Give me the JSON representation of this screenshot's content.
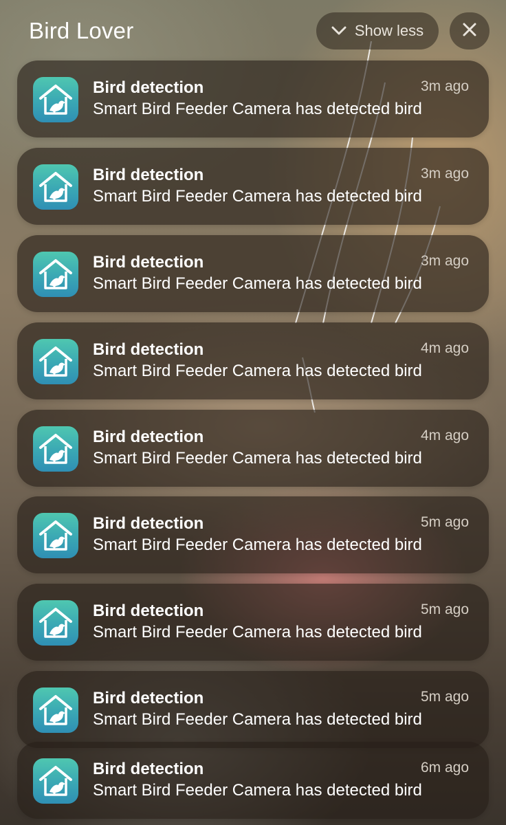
{
  "header": {
    "app_name": "Bird Lover",
    "show_less_label": "Show less",
    "chevron_icon": "chevron-down-icon",
    "close_icon": "close-icon"
  },
  "notifications": [
    {
      "title": "Bird detection",
      "body": "Smart Bird Feeder Camera has detected bird",
      "time": "3m ago"
    },
    {
      "title": "Bird detection",
      "body": "Smart Bird Feeder Camera has detected bird",
      "time": "3m ago"
    },
    {
      "title": "Bird detection",
      "body": "Smart Bird Feeder Camera has detected bird",
      "time": "3m ago"
    },
    {
      "title": "Bird detection",
      "body": "Smart Bird Feeder Camera has detected bird",
      "time": "4m ago"
    },
    {
      "title": "Bird detection",
      "body": "Smart Bird Feeder Camera has detected bird",
      "time": "4m ago"
    },
    {
      "title": "Bird detection",
      "body": "Smart Bird Feeder Camera has detected bird",
      "time": "5m ago"
    },
    {
      "title": "Bird detection",
      "body": "Smart Bird Feeder Camera has detected bird",
      "time": "5m ago"
    },
    {
      "title": "Bird detection",
      "body": "Smart Bird Feeder Camera has detected bird",
      "time": "5m ago"
    },
    {
      "title": "Bird detection",
      "body": "Smart Bird Feeder Camera has detected bird",
      "time": "6m ago"
    }
  ],
  "colors": {
    "icon_gradient_top": "#4fc7b0",
    "icon_gradient_bottom": "#2f8fb4",
    "card_background": "#261f18"
  }
}
